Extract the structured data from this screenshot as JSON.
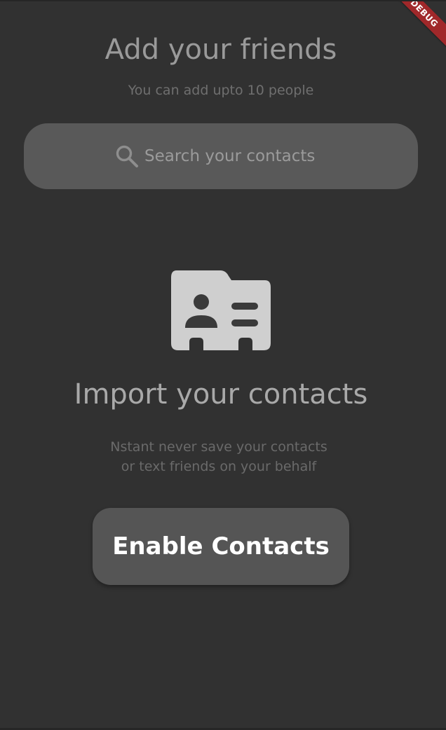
{
  "header": {
    "title": "Add your friends",
    "subtitle": "You can add upto 10 people"
  },
  "search": {
    "placeholder": "Search your contacts",
    "icon": "search-icon"
  },
  "empty_state": {
    "icon": "contact-card-icon",
    "title": "Import your contacts",
    "privacy_line_1": "Nstant never save your contacts",
    "privacy_line_2": "or text friends on your behalf"
  },
  "actions": {
    "enable_label": "Enable Contacts"
  },
  "debug_banner": {
    "label": "DEBUG"
  },
  "colors": {
    "background": "#313131",
    "surface": "#595959",
    "button": "#555555",
    "ribbon": "#a0282a"
  }
}
